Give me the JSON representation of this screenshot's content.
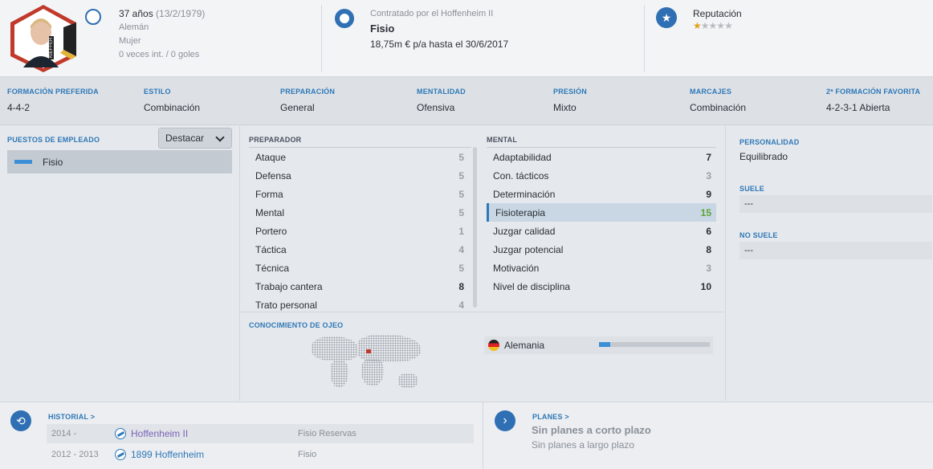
{
  "profile": {
    "photo_caption": "KIEFFER",
    "age": "37 años",
    "birth": "(13/2/1979)",
    "nationality": "Alemán",
    "gender": "Mujer",
    "caps": "0 veces int. / 0 goles"
  },
  "contract": {
    "label": "Contratado por el Hoffenheim II",
    "role": "Fisio",
    "salary": "18,75m € p/a hasta el 30/6/2017"
  },
  "reputation": {
    "label": "Reputación",
    "stars_filled": 1,
    "stars_total": 5,
    "star_full": "★",
    "star_empty": "★"
  },
  "tactics": [
    {
      "label": "FORMACIÓN PREFERIDA",
      "value": "4-4-2"
    },
    {
      "label": "ESTILO",
      "value": "Combinación"
    },
    {
      "label": "PREPARACIÓN",
      "value": "General"
    },
    {
      "label": "MENTALIDAD",
      "value": "Ofensiva"
    },
    {
      "label": "PRESIÓN",
      "value": "Mixto"
    },
    {
      "label": "MARCAJES",
      "value": "Combinación"
    },
    {
      "label": "2ª FORMACIÓN FAVORITA",
      "value": "4-2-3-1 Abierta"
    }
  ],
  "jobs": {
    "title": "PUESTOS DE EMPLEADO",
    "dropdown": "Destacar",
    "items": [
      "Fisio"
    ]
  },
  "coaching": {
    "title": "PREPARADOR",
    "rows": [
      {
        "label": "Ataque",
        "value": "5"
      },
      {
        "label": "Defensa",
        "value": "5"
      },
      {
        "label": "Forma",
        "value": "5"
      },
      {
        "label": "Mental",
        "value": "5"
      },
      {
        "label": "Portero",
        "value": "1"
      },
      {
        "label": "Táctica",
        "value": "4"
      },
      {
        "label": "Técnica",
        "value": "5"
      },
      {
        "label": "Trabajo cantera",
        "value": "8"
      },
      {
        "label": "Trato personal",
        "value": "4"
      }
    ]
  },
  "mental": {
    "title": "MENTAL",
    "rows": [
      {
        "label": "Adaptabilidad",
        "value": "7"
      },
      {
        "label": "Con. tácticos",
        "value": "3"
      },
      {
        "label": "Determinación",
        "value": "9"
      },
      {
        "label": "Fisioterapia",
        "value": "15"
      },
      {
        "label": "Juzgar calidad",
        "value": "6"
      },
      {
        "label": "Juzgar potencial",
        "value": "8"
      },
      {
        "label": "Motivación",
        "value": "3"
      },
      {
        "label": "Nivel de disciplina",
        "value": "10"
      }
    ]
  },
  "scouting": {
    "title": "CONOCIMIENTO DE OJEO",
    "country": "Alemania",
    "knowledge_fraction": 0.1
  },
  "personality": {
    "title": "PERSONALIDAD",
    "value": "Equilibrado",
    "usually_title": "SUELE",
    "usually_value": "---",
    "not_usually_title": "NO SUELE",
    "not_usually_value": "---"
  },
  "history": {
    "title": "HISTORIAL",
    "chevron": ">",
    "rows": [
      {
        "years": "2014 -",
        "club": "Hoffenheim II",
        "role": "Fisio Reservas"
      },
      {
        "years": "2012 - 2013",
        "club": "1899 Hoffenheim",
        "role": "Fisio"
      }
    ]
  },
  "plans": {
    "title": "PLANES",
    "chevron": ">",
    "short": "Sin planes a corto plazo",
    "long": "Sin planes a largo plazo"
  },
  "colors": {
    "accent": "#2e78b7",
    "highlight_green": "#5aa532",
    "star": "#e0a21b"
  }
}
